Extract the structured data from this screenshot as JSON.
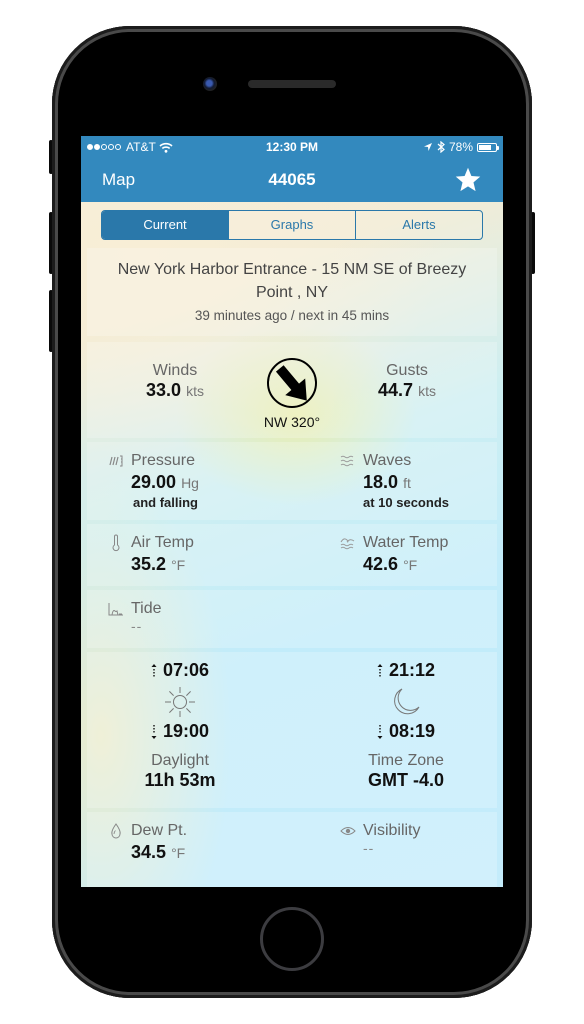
{
  "status_bar": {
    "carrier": "AT&T",
    "signal_bars_filled": 2,
    "signal_bars_total": 5,
    "time": "12:30 PM",
    "battery_percent_label": "78%",
    "battery_level": 0.78
  },
  "nav": {
    "back_label": "Map",
    "title": "44065",
    "favorite_icon": "star-icon"
  },
  "tabs": [
    {
      "label": "Current",
      "active": true
    },
    {
      "label": "Graphs",
      "active": false
    },
    {
      "label": "Alerts",
      "active": false
    }
  ],
  "station": {
    "name": "New York Harbor Entrance - 15 NM SE of Breezy Point , NY",
    "updated": "39 minutes ago / next in 45 mins"
  },
  "wind": {
    "winds_label": "Winds",
    "winds_value": "33.0",
    "winds_unit": "kts",
    "gusts_label": "Gusts",
    "gusts_value": "44.7",
    "gusts_unit": "kts",
    "direction_label": "NW 320°",
    "direction_degrees": 320
  },
  "pressure": {
    "label": "Pressure",
    "value": "29.00",
    "unit": "Hg",
    "trend": "and falling",
    "icon": "barometer-icon"
  },
  "waves": {
    "label": "Waves",
    "value": "18.0",
    "unit": "ft",
    "period": "at 10 seconds",
    "icon": "waves-icon"
  },
  "air_temp": {
    "label": "Air Temp",
    "value": "35.2",
    "unit": "°F",
    "icon": "thermometer-icon"
  },
  "water_temp": {
    "label": "Water Temp",
    "value": "42.6",
    "unit": "°F",
    "icon": "water-temp-icon"
  },
  "tide": {
    "label": "Tide",
    "value": "--",
    "icon": "tide-chart-icon"
  },
  "sun": {
    "rise": "07:06",
    "set": "19:00",
    "daylight_label": "Daylight",
    "daylight_value": "11h 53m"
  },
  "moon": {
    "rise": "21:12",
    "set": "08:19",
    "timezone_label": "Time Zone",
    "timezone_value": "GMT -4.0"
  },
  "dew_point": {
    "label": "Dew Pt.",
    "value": "34.5",
    "unit": "°F",
    "icon": "droplet-icon"
  },
  "visibility": {
    "label": "Visibility",
    "value": "--",
    "icon": "eye-icon"
  },
  "colors": {
    "nav_bar": "#3389be",
    "segment_accent": "#2a78aa"
  }
}
